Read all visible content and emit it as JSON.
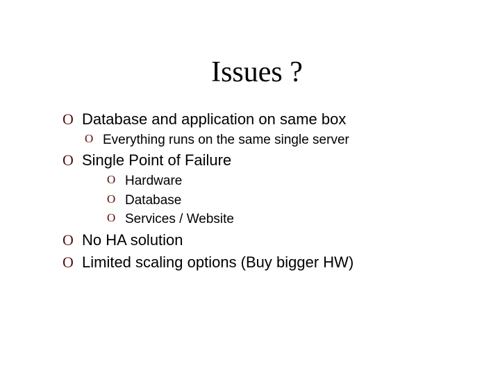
{
  "title": "Issues ?",
  "bullets": {
    "b1": "Database and application on same box",
    "b1_1": "Everything runs on the same single server",
    "b2": "Single Point of Failure",
    "b2_1": "Hardware",
    "b2_2": "Database",
    "b2_3": "Services / Website",
    "b3": "No HA solution",
    "b4": "Limited scaling options (Buy bigger HW)"
  },
  "marker": "O"
}
